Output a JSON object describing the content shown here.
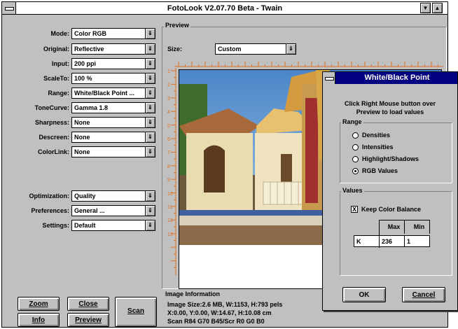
{
  "window": {
    "title": "FotoLook V2.07.70 Beta - Twain",
    "min_glyph": "▼",
    "max_glyph": "▲"
  },
  "arrow_glyph": "⇓",
  "settings": [
    {
      "label": "Mode:",
      "value": "Color RGB"
    },
    {
      "label": "Original:",
      "value": "Reflective"
    },
    {
      "label": "Input:",
      "value": "200 ppi"
    },
    {
      "label": "ScaleTo:",
      "value": "100 %"
    },
    {
      "label": "Range:",
      "value": "White/Black Point ..."
    },
    {
      "label": "ToneCurve:",
      "value": "Gamma 1.8"
    },
    {
      "label": "Sharpness:",
      "value": "None"
    },
    {
      "label": "Descreen:",
      "value": "None"
    },
    {
      "label": "ColorLink:",
      "value": "None"
    }
  ],
  "lower_settings": [
    {
      "label": "Optimization:",
      "value": "Quality"
    },
    {
      "label": "Preferences:",
      "value": "General ..."
    },
    {
      "label": "Settings:",
      "value": "Default"
    }
  ],
  "buttons": {
    "zoom": "Zoom",
    "close": "Close",
    "info": "Info",
    "preview": "Preview",
    "scan": "Scan"
  },
  "preview": {
    "heading": "Preview",
    "size_label": "Size:",
    "size_value": "Custom",
    "ruler_left": [
      "1",
      "2",
      "3",
      "4",
      "5",
      "6",
      "7",
      "8",
      "9",
      "10",
      "11",
      "12",
      "13"
    ]
  },
  "image_info": {
    "heading": "Image Information",
    "line1": "Image Size:2.6 MB, W:1153, H:793 pels",
    "line2": "X:0.00, Y:0.00, W:14.67, H:10.08 cm",
    "line3": "Scan R84 G70 B45/Scr R0 G0 B0"
  },
  "dialog": {
    "title": "White/Black Point",
    "instruction1": "Click Right Mouse button over",
    "instruction2": "Preview to load values",
    "range_heading": "Range",
    "range_options": [
      "Densities",
      "Intensities",
      "Highlight/Shadows",
      "RGB Values"
    ],
    "selected_range": "RGB Values",
    "values_heading": "Values",
    "keep_balance_label": "Keep Color Balance",
    "keep_balance_checked": true,
    "check_mark": "X",
    "col_max": "Max",
    "col_min": "Min",
    "row_label": "K",
    "max_value": "236",
    "min_value": "1",
    "ok": "OK",
    "cancel": "Cancel"
  },
  "colors": {
    "face": "#c0c0c0",
    "title_active": "#000080",
    "ruler_mark": "#e07020"
  }
}
